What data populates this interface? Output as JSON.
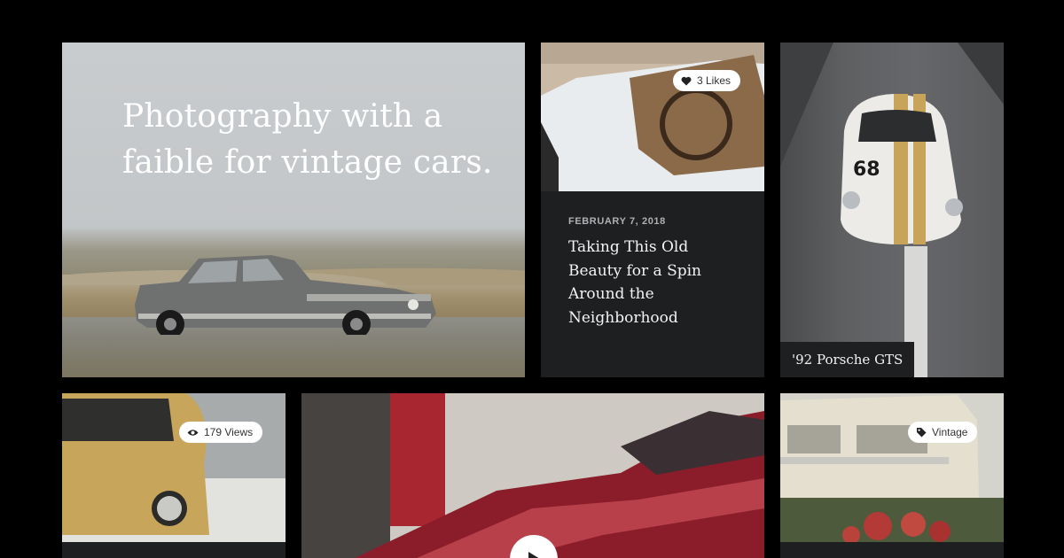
{
  "hero": {
    "title": "Photography with a faible for vintage cars."
  },
  "post": {
    "likes": "3 Likes",
    "date": "FEBRUARY 7, 2018",
    "title": "Taking This Old Beauty for a Spin Around the Neighborhood"
  },
  "porsche": {
    "caption": "'92 Porsche GTS"
  },
  "beetle": {
    "views": "179 Views"
  },
  "volvo": {
    "tag": "Vintage"
  },
  "colors": {
    "background": "#000000",
    "card": "#1e1f21",
    "badge": "#ffffff"
  },
  "icons": [
    "heart-icon",
    "eye-icon",
    "tag-icon",
    "play-icon"
  ]
}
